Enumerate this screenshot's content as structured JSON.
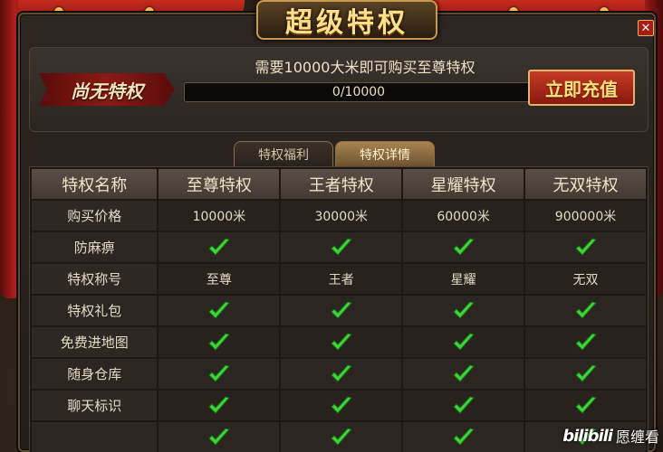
{
  "window": {
    "title": "超级特权"
  },
  "status": {
    "rank_label": "尚无特权",
    "requirement_text": "需要10000大米即可购买至尊特权",
    "progress_text": "0/10000",
    "progress_fraction": 0,
    "recharge_label": "立即充值"
  },
  "tabs": [
    {
      "label": "特权福利",
      "active": false
    },
    {
      "label": "特权详情",
      "active": true
    }
  ],
  "table": {
    "headers": [
      "特权名称",
      "至尊特权",
      "王者特权",
      "星耀特权",
      "无双特权"
    ],
    "rows": [
      {
        "name": "购买价格",
        "cells": [
          "10000米",
          "30000米",
          "60000米",
          "900000米"
        ]
      },
      {
        "name": "防麻痹",
        "cells": [
          "check",
          "check",
          "check",
          "check"
        ]
      },
      {
        "name": "特权称号",
        "cells": [
          "至尊",
          "王者",
          "星耀",
          "无双"
        ]
      },
      {
        "name": "特权礼包",
        "cells": [
          "check",
          "check",
          "check",
          "check"
        ]
      },
      {
        "name": "免费进地图",
        "cells": [
          "check",
          "check",
          "check",
          "check"
        ]
      },
      {
        "name": "随身仓库",
        "cells": [
          "check",
          "check",
          "check",
          "check"
        ]
      },
      {
        "name": "聊天标识",
        "cells": [
          "check",
          "check",
          "check",
          "check"
        ]
      },
      {
        "name": "",
        "cells": [
          "check",
          "check",
          "check",
          "check"
        ]
      }
    ]
  },
  "watermark": {
    "logo": "bilibili",
    "text": "愿缠看"
  },
  "colors": {
    "check": "#3fd43a",
    "accent_gold": "#e2b46a",
    "button_red": "#b02a1a"
  }
}
